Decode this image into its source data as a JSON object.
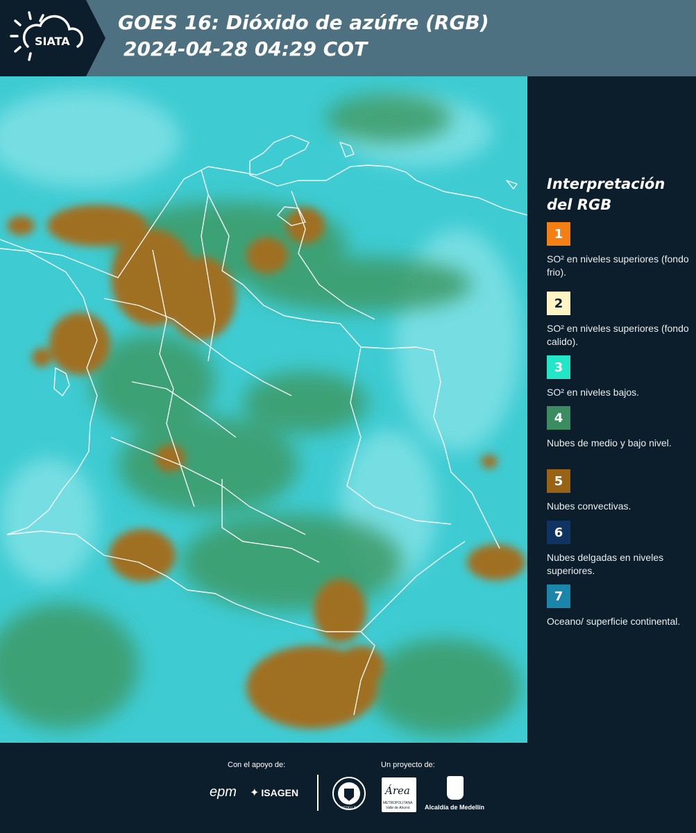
{
  "header": {
    "title_line1": "GOES 16: Dióxido de azúfre (RGB)",
    "title_line2": "2024-04-28 04:29 COT",
    "logo_text": "SIATA"
  },
  "legend": {
    "title_line1": "Interpretación",
    "title_line2": "del RGB",
    "items": [
      {
        "number": "1",
        "color": "#f47f12",
        "text_color": "#ffffff",
        "label": "SO² en niveles superiores (fondo frio)."
      },
      {
        "number": "2",
        "color": "#fff4c4",
        "text_color": "#0c1e2b",
        "label": "SO² en niveles superiores (fondo calido)."
      },
      {
        "number": "3",
        "color": "#21e6c8",
        "text_color": "#ffffff",
        "label": "SO² en niveles bajos."
      },
      {
        "number": "4",
        "color": "#3c8c62",
        "text_color": "#ffffff",
        "label": "Nubes de medio y bajo nivel."
      },
      {
        "number": "5",
        "color": "#996316",
        "text_color": "#ffffff",
        "label": "Nubes convectivas."
      },
      {
        "number": "6",
        "color": "#0f3462",
        "text_color": "#ffffff",
        "label": "Nubes delgadas en niveles superiores."
      },
      {
        "number": "7",
        "color": "#1a86aa",
        "text_color": "#ffffff",
        "label": "Oceano/ superficie continental."
      }
    ]
  },
  "map": {
    "base_color": "#3ecbd2",
    "green_color": "#3d9a66",
    "convective_color": "#a07024",
    "border_color": "#ffffff"
  },
  "footer": {
    "support_label": "Con el apoyo de:",
    "project_label": "Un proyecto de:",
    "sponsor_epm": "epm",
    "sponsor_isagen": "ISAGEN",
    "partner_area": "Área",
    "partner_area_sub1": "METROPOLITANA",
    "partner_area_sub2": "Valle de Aburrá",
    "partner_alcaldia": "Alcaldía de Medellín",
    "seal_text": "MEDELLÍN"
  }
}
